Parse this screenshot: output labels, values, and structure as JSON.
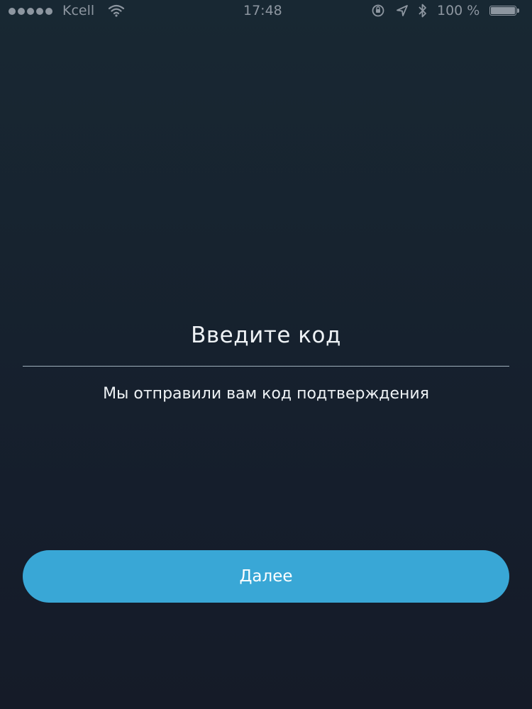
{
  "status_bar": {
    "carrier": "Kcell",
    "time": "17:48",
    "battery_percent": "100 %",
    "battery_level": 1.0,
    "icons": {
      "signal": "signal-dots-icon",
      "wifi": "wifi-icon",
      "rotation_lock": "rotation-lock-icon",
      "location": "location-arrow-icon",
      "bluetooth": "bluetooth-icon",
      "battery": "battery-icon"
    }
  },
  "verification": {
    "title": "Введите код",
    "code_value": "",
    "subtitle": "Мы отправили вам код подтверждения"
  },
  "actions": {
    "next_label": "Далее"
  },
  "colors": {
    "background": "#172331",
    "accent": "#39a7d6",
    "text": "#eef2f5",
    "status_text": "#8d96a0"
  }
}
